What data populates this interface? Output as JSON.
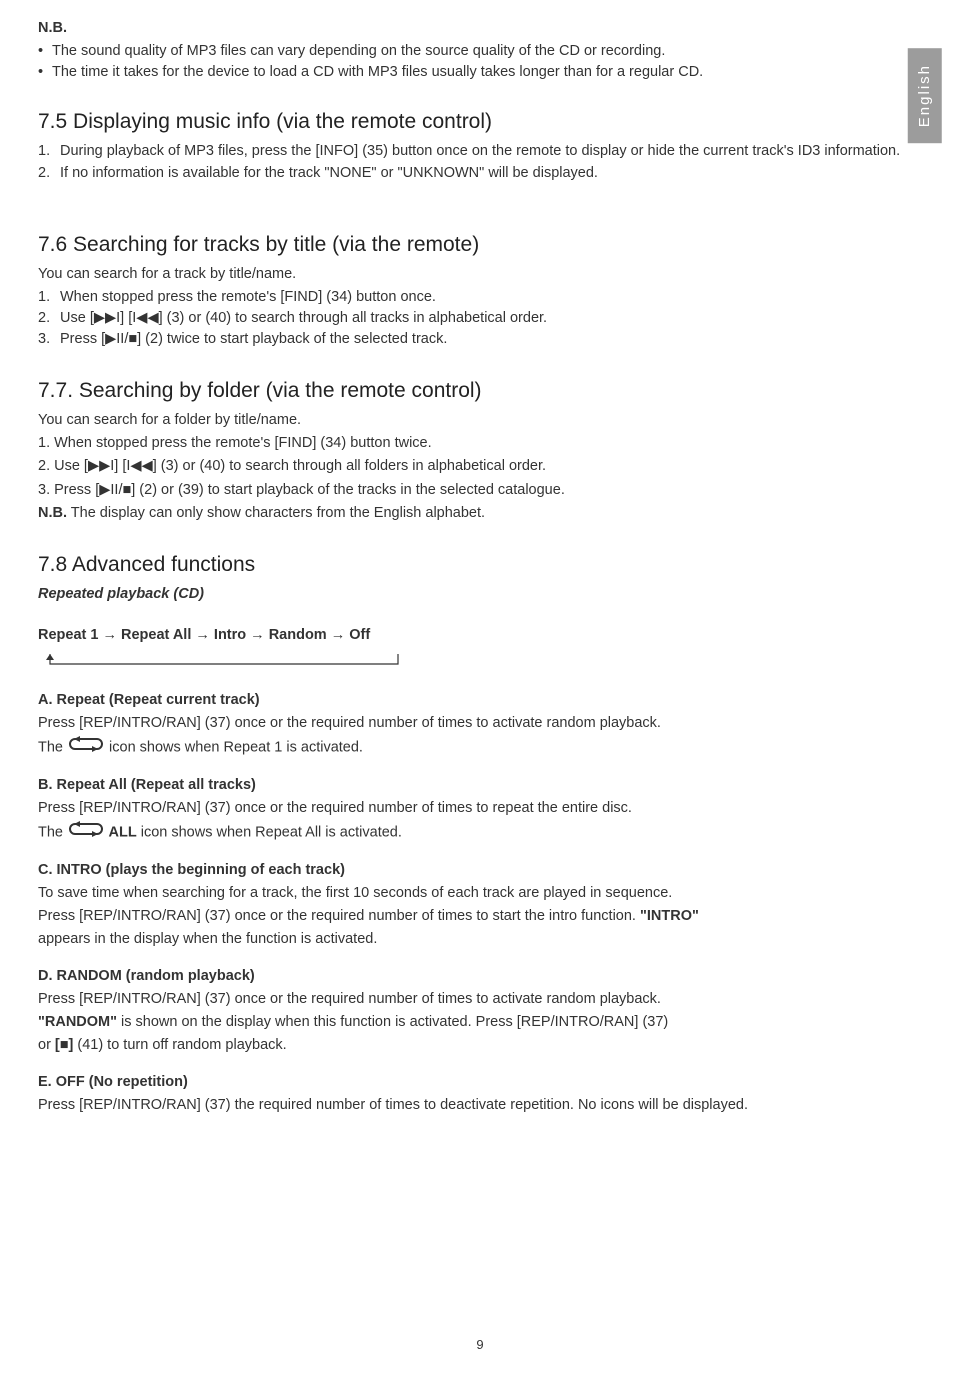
{
  "sideTab": "English",
  "nb": {
    "label": "N.B.",
    "items": [
      "The sound quality of MP3 files can vary depending on the source quality of the CD or recording.",
      "The time it takes for the device to load a CD with MP3 files usually takes longer than for a regular CD."
    ]
  },
  "s75": {
    "heading": "7.5 Displaying music info (via the remote control)",
    "items": [
      "During playback of MP3 files, press the [INFO] (35) button once on the remote to display or hide the current track's ID3 information.",
      "If no information is available for the track \"NONE\" or \"UNKNOWN\" will be displayed."
    ]
  },
  "s76": {
    "heading": "7.6 Searching for tracks by title (via the remote)",
    "intro": "You can search for a track by title/name.",
    "items": [
      "When stopped press the remote's [FIND] (34) button once.",
      "Use [▶▶I] [I◀◀] (3) or (40) to search through all tracks in alphabetical order.",
      "Press [▶II/■] (2) twice to start playback of the selected track."
    ]
  },
  "s77": {
    "heading": "7.7. Searching by folder (via the remote control)",
    "intro": "You can search for a folder by title/name.",
    "items": [
      "1. When stopped press the remote's [FIND] (34) button twice.",
      "2. Use [▶▶I] [I◀◀] (3) or (40) to search through all folders in alphabetical order.",
      "3. Press [▶II/■] (2) or (39) to start playback of the tracks in the selected catalogue."
    ],
    "nbLabel": "N.B.",
    "nbText": " The display can only show characters from the English alphabet."
  },
  "s78": {
    "heading": "7.8 Advanced functions",
    "subhead": "Repeated playback (CD)",
    "sequence": "Repeat 1 → Repeat All → Intro → Random → Off"
  },
  "adv": {
    "a": {
      "title": "A. Repeat (Repeat current track)",
      "line1": "Press [REP/INTRO/RAN] (37) once or the required number of times to activate random playback.",
      "pre": "The ",
      "post": " icon shows when Repeat 1 is activated."
    },
    "b": {
      "title": "B. Repeat All (Repeat all tracks)",
      "line1": "Press [REP/INTRO/RAN] (37) once or the required number of times to repeat the entire disc.",
      "pre": "The ",
      "allLabel": " ALL",
      "post": " icon shows when Repeat All is activated."
    },
    "c": {
      "title": "C. INTRO (plays the beginning of each track)",
      "line1": "To save time when searching for a track, the first 10 seconds of each track are played in sequence.",
      "line2a": "Press [REP/INTRO/RAN] (37) once or the required number of times to start the intro function. ",
      "line2b": "\"INTRO\"",
      "line3": "appears in the display when the function is activated."
    },
    "d": {
      "title": "D. RANDOM (random playback)",
      "line1": "Press [REP/INTRO/RAN] (37) once or the required number of times to activate random playback.",
      "line2a": "\"RANDOM\"",
      "line2b": " is shown on the display when this function is activated. Press [REP/INTRO/RAN] (37)",
      "line3a": "or ",
      "line3b": "[■]",
      "line3c": " (41) to turn off random playback."
    },
    "e": {
      "title": "E. OFF (No repetition)",
      "line1": "Press [REP/INTRO/RAN] (37) the required number of times to deactivate repetition. No icons will be displayed."
    }
  },
  "pageNumber": "9"
}
